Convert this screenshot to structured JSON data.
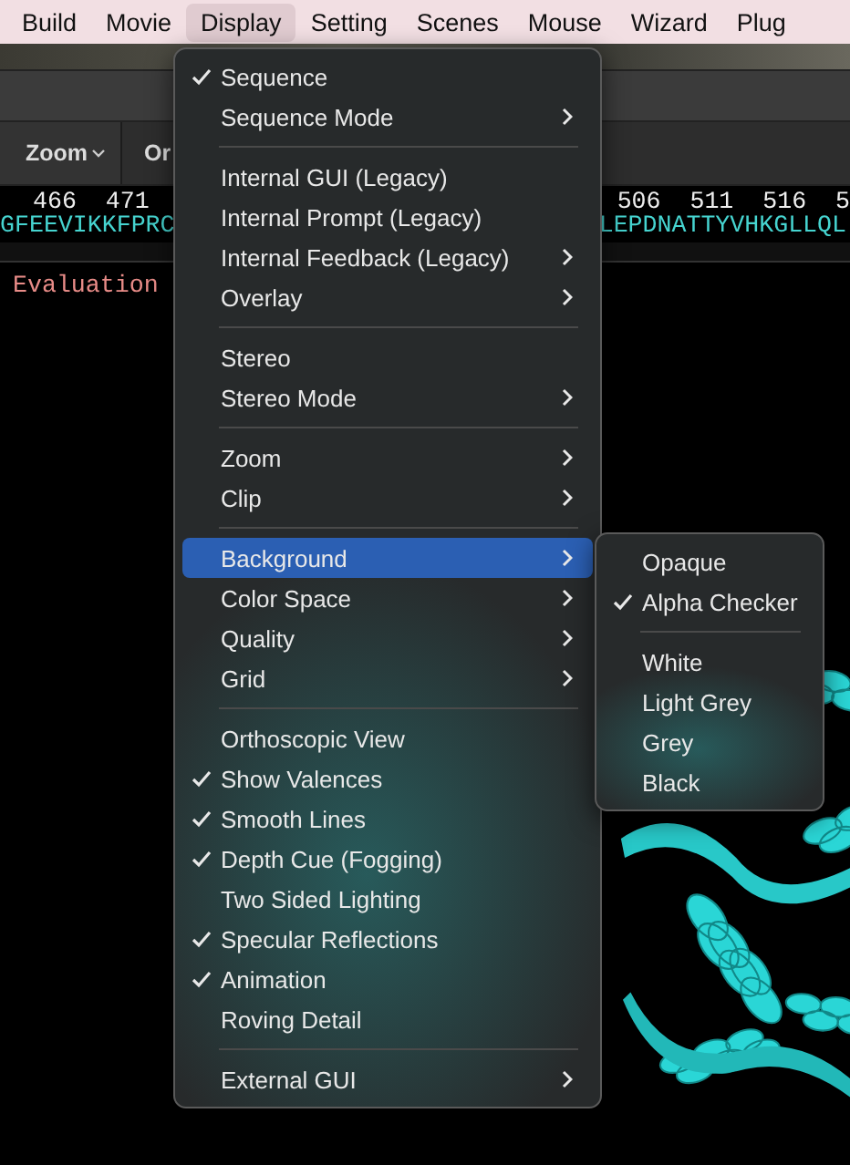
{
  "menubar": [
    {
      "label": "Build",
      "selected": false
    },
    {
      "label": "Movie",
      "selected": false
    },
    {
      "label": "Display",
      "selected": true
    },
    {
      "label": "Setting",
      "selected": false
    },
    {
      "label": "Scenes",
      "selected": false
    },
    {
      "label": "Mouse",
      "selected": false
    },
    {
      "label": "Wizard",
      "selected": false
    },
    {
      "label": "Plug",
      "selected": false
    }
  ],
  "toolbar": {
    "zoom_button": "Zoom",
    "cut_label": "Or"
  },
  "sequence": {
    "numbers_left": "466  471",
    "numbers_right": "506  511  516  5",
    "residues_left": "GFEEVIKKFPRC",
    "residues_right": "LEPDNATTYVHKGLLQL"
  },
  "output": {
    "text": "Evaluation"
  },
  "menu": {
    "items": [
      {
        "kind": "item",
        "label": "Sequence",
        "checked": true,
        "selected": false,
        "submenu": false
      },
      {
        "kind": "item",
        "label": "Sequence Mode",
        "checked": false,
        "selected": false,
        "submenu": true
      },
      {
        "kind": "separator"
      },
      {
        "kind": "item",
        "label": "Internal GUI (Legacy)",
        "checked": false,
        "selected": false,
        "submenu": false
      },
      {
        "kind": "item",
        "label": "Internal Prompt (Legacy)",
        "checked": false,
        "selected": false,
        "submenu": false
      },
      {
        "kind": "item",
        "label": "Internal Feedback (Legacy)",
        "checked": false,
        "selected": false,
        "submenu": true
      },
      {
        "kind": "item",
        "label": "Overlay",
        "checked": false,
        "selected": false,
        "submenu": true
      },
      {
        "kind": "separator"
      },
      {
        "kind": "item",
        "label": "Stereo",
        "checked": false,
        "selected": false,
        "submenu": false
      },
      {
        "kind": "item",
        "label": "Stereo Mode",
        "checked": false,
        "selected": false,
        "submenu": true
      },
      {
        "kind": "separator"
      },
      {
        "kind": "item",
        "label": "Zoom",
        "checked": false,
        "selected": false,
        "submenu": true
      },
      {
        "kind": "item",
        "label": "Clip",
        "checked": false,
        "selected": false,
        "submenu": true
      },
      {
        "kind": "separator"
      },
      {
        "kind": "item",
        "label": "Background",
        "checked": false,
        "selected": true,
        "submenu": true
      },
      {
        "kind": "item",
        "label": "Color Space",
        "checked": false,
        "selected": false,
        "submenu": true
      },
      {
        "kind": "item",
        "label": "Quality",
        "checked": false,
        "selected": false,
        "submenu": true
      },
      {
        "kind": "item",
        "label": "Grid",
        "checked": false,
        "selected": false,
        "submenu": true
      },
      {
        "kind": "separator"
      },
      {
        "kind": "item",
        "label": "Orthoscopic View",
        "checked": false,
        "selected": false,
        "submenu": false
      },
      {
        "kind": "item",
        "label": "Show Valences",
        "checked": true,
        "selected": false,
        "submenu": false
      },
      {
        "kind": "item",
        "label": "Smooth Lines",
        "checked": true,
        "selected": false,
        "submenu": false
      },
      {
        "kind": "item",
        "label": "Depth Cue (Fogging)",
        "checked": true,
        "selected": false,
        "submenu": false
      },
      {
        "kind": "item",
        "label": "Two Sided Lighting",
        "checked": false,
        "selected": false,
        "submenu": false
      },
      {
        "kind": "item",
        "label": "Specular Reflections",
        "checked": true,
        "selected": false,
        "submenu": false
      },
      {
        "kind": "item",
        "label": "Animation",
        "checked": true,
        "selected": false,
        "submenu": false
      },
      {
        "kind": "item",
        "label": "Roving Detail",
        "checked": false,
        "selected": false,
        "submenu": false
      },
      {
        "kind": "separator"
      },
      {
        "kind": "item",
        "label": "External GUI",
        "checked": false,
        "selected": false,
        "submenu": true
      }
    ]
  },
  "submenu": {
    "items": [
      {
        "kind": "item",
        "label": "Opaque",
        "checked": false,
        "selected": false,
        "submenu": false
      },
      {
        "kind": "item",
        "label": "Alpha Checker",
        "checked": true,
        "selected": false,
        "submenu": false
      },
      {
        "kind": "separator"
      },
      {
        "kind": "item",
        "label": "White",
        "checked": false,
        "selected": false,
        "submenu": false
      },
      {
        "kind": "item",
        "label": "Light Grey",
        "checked": false,
        "selected": false,
        "submenu": false
      },
      {
        "kind": "item",
        "label": "Grey",
        "checked": false,
        "selected": false,
        "submenu": false
      },
      {
        "kind": "item",
        "label": "Black",
        "checked": false,
        "selected": false,
        "submenu": false
      }
    ]
  }
}
